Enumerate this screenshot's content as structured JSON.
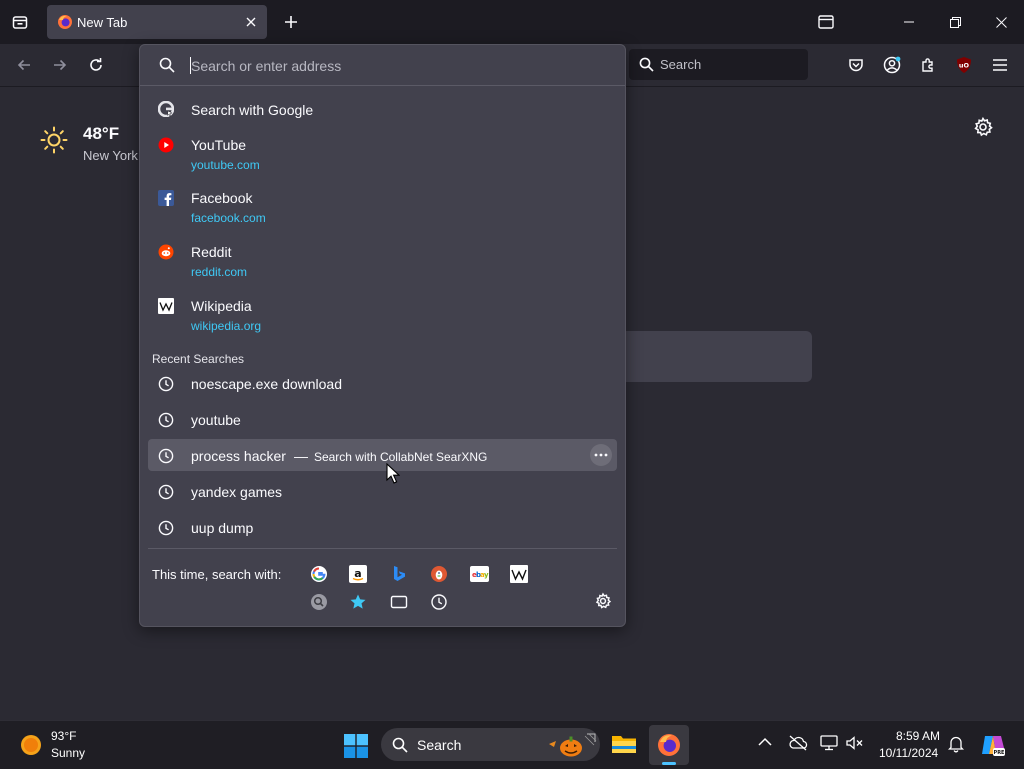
{
  "tab": {
    "title": "New Tab"
  },
  "toolbar": {
    "search_placeholder": "Search"
  },
  "urlbar": {
    "placeholder": "Search or enter address"
  },
  "weather": {
    "temp": "48°F",
    "location": "New York"
  },
  "suggestions": {
    "search_google": "Search with Google",
    "sites": [
      {
        "title": "YouTube",
        "url": "youtube.com",
        "icon": "youtube-icon"
      },
      {
        "title": "Facebook",
        "url": "facebook.com",
        "icon": "facebook-icon"
      },
      {
        "title": "Reddit",
        "url": "reddit.com",
        "icon": "reddit-icon"
      },
      {
        "title": "Wikipedia",
        "url": "wikipedia.org",
        "icon": "wikipedia-icon"
      }
    ],
    "recent_label": "Recent Searches",
    "recent": [
      {
        "text": "noescape.exe download"
      },
      {
        "text": "youtube"
      },
      {
        "text": "process hacker",
        "separator": "—",
        "action": "Search with CollabNet SearXNG"
      },
      {
        "text": "yandex games"
      },
      {
        "text": "uup dump"
      }
    ]
  },
  "oneoff": {
    "label": "This time, search with:",
    "engines": [
      "google-icon",
      "amazon-icon",
      "bing-icon",
      "duckduckgo-icon",
      "ebay-icon",
      "wikipedia-icon"
    ],
    "modes": [
      "searxng-icon",
      "bookmarks-icon",
      "tabs-icon",
      "history-icon"
    ]
  },
  "taskbar": {
    "weather_temp": "93°F",
    "weather_cond": "Sunny",
    "search_label": "Search",
    "time": "8:59 AM",
    "date": "10/11/2024"
  },
  "colors": {
    "accent_link": "#3fc9f5",
    "popup_bg": "#42414d",
    "page_bg": "#2b2a33",
    "tabstrip_bg": "#1c1b22"
  }
}
